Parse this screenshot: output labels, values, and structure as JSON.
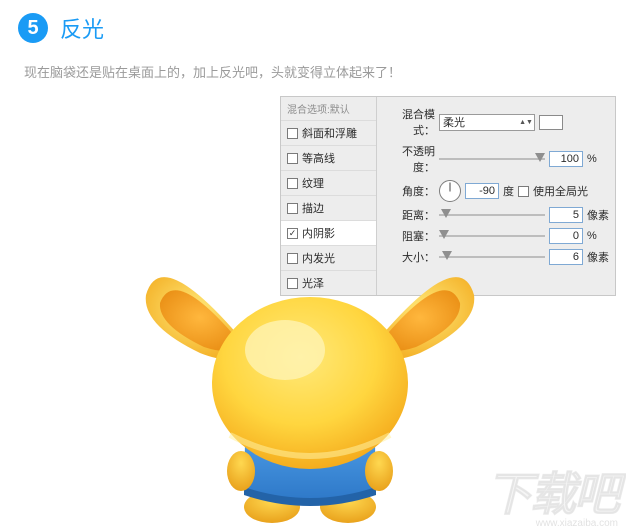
{
  "step": {
    "number": "5",
    "title": "反光"
  },
  "subtitle": "现在脑袋还是贴在桌面上的，加上反光吧，头就变得立体起来了！",
  "panel": {
    "listHeader": "混合选项:默认",
    "items": [
      {
        "label": "斜面和浮雕",
        "checked": false,
        "selected": false
      },
      {
        "label": "等高线",
        "checked": false,
        "selected": false
      },
      {
        "label": "纹理",
        "checked": false,
        "selected": false
      },
      {
        "label": "描边",
        "checked": false,
        "selected": false
      },
      {
        "label": "内阴影",
        "checked": true,
        "selected": true
      },
      {
        "label": "内发光",
        "checked": false,
        "selected": false
      },
      {
        "label": "光泽",
        "checked": false,
        "selected": false
      }
    ],
    "blendMode_label": "混合模式：",
    "blendMode_value": "柔光",
    "opacity_label": "不透明度：",
    "opacity_value": "100",
    "opacity_unit": "%",
    "angle_label": "角度：",
    "angle_value": "-90",
    "angle_unit_deg": "度",
    "globalLight_label": "使用全局光",
    "distance_label": "距离：",
    "distance_value": "5",
    "px_unit": "像素",
    "choke_label": "阻塞：",
    "choke_value": "0",
    "size_label": "大小：",
    "size_value": "6"
  },
  "watermark": {
    "main": "下载吧",
    "url": "www.xiazaiba.com"
  }
}
